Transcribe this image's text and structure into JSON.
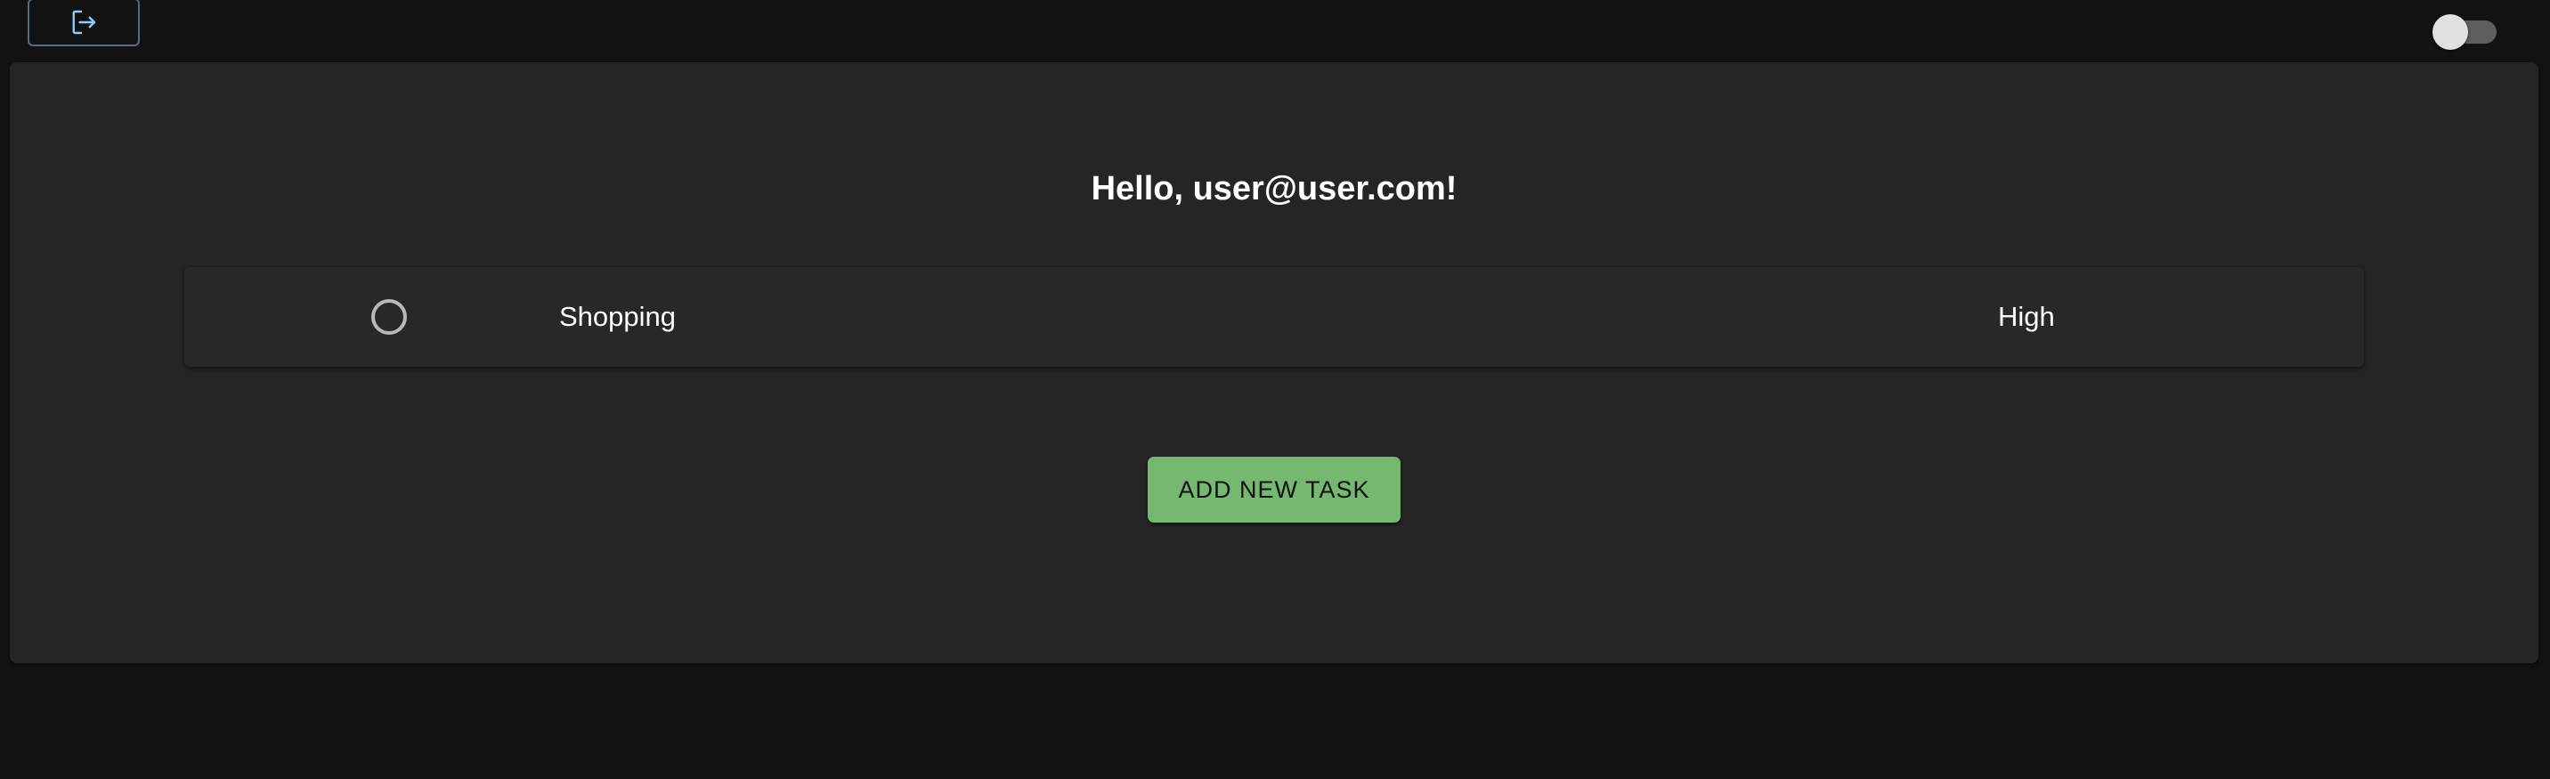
{
  "header": {
    "logout_icon": "logout-icon",
    "theme_toggle": {
      "state": "off"
    }
  },
  "main": {
    "greeting": "Hello, user@user.com!",
    "tasks": [
      {
        "name": "Shopping",
        "priority": "High",
        "completed": false
      }
    ],
    "add_button_label": "ADD NEW TASK"
  },
  "colors": {
    "background": "#121212",
    "card": "#252525",
    "task_row": "#282828",
    "accent_green": "#74b96f",
    "outline_blue": "#90caf9"
  }
}
